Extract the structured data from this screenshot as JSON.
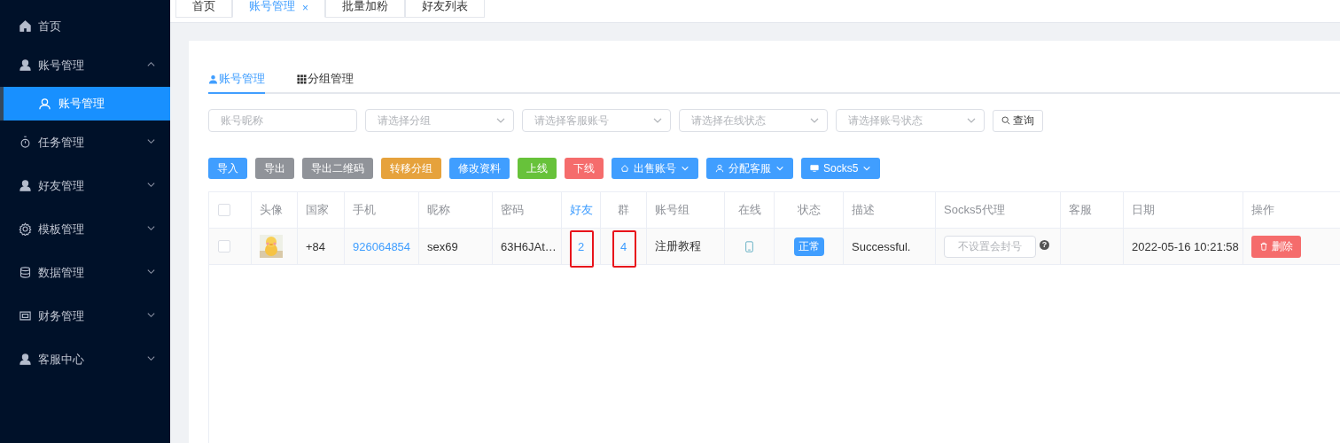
{
  "sidebar": {
    "items": [
      {
        "label": "首页",
        "kind": "link"
      },
      {
        "label": "账号管理",
        "kind": "menu",
        "expanded": true,
        "children": [
          {
            "label": "账号管理",
            "selected": true
          }
        ]
      },
      {
        "label": "任务管理",
        "kind": "menu",
        "expanded": false
      },
      {
        "label": "好友管理",
        "kind": "menu",
        "expanded": false
      },
      {
        "label": "模板管理",
        "kind": "menu",
        "expanded": false
      },
      {
        "label": "数据管理",
        "kind": "menu",
        "expanded": false
      },
      {
        "label": "财务管理",
        "kind": "menu",
        "expanded": false
      },
      {
        "label": "客服中心",
        "kind": "menu",
        "expanded": false
      }
    ]
  },
  "tabs": [
    {
      "label": "首页",
      "selected": false
    },
    {
      "label": "账号管理",
      "selected": true,
      "close": "×"
    },
    {
      "label": "批量加粉",
      "selected": false
    },
    {
      "label": "好友列表",
      "selected": false
    }
  ],
  "page_tabs": [
    {
      "label": "账号管理",
      "selected": true
    },
    {
      "label": "分组管理",
      "selected": false
    }
  ],
  "filters": [
    {
      "kind": "input",
      "placeholder": "账号昵称"
    },
    {
      "kind": "select",
      "placeholder": "请选择分组"
    },
    {
      "kind": "select",
      "placeholder": "请选择客服账号"
    },
    {
      "kind": "select",
      "placeholder": "请选择在线状态"
    },
    {
      "kind": "select",
      "placeholder": "请选择账号状态"
    }
  ],
  "search_button": "查询",
  "actions": [
    {
      "label": "导入",
      "color": "#409eff",
      "kind": "plain"
    },
    {
      "label": "导出",
      "color": "#909399",
      "kind": "plain"
    },
    {
      "label": "导出二维码",
      "color": "#909399",
      "kind": "plain"
    },
    {
      "label": "转移分组",
      "color": "#e6a23c",
      "kind": "plain"
    },
    {
      "label": "修改资料",
      "color": "#409eff",
      "kind": "plain"
    },
    {
      "label": "上线",
      "color": "#67c23a",
      "kind": "plain"
    },
    {
      "label": "下线",
      "color": "#f56c6c",
      "kind": "plain"
    },
    {
      "label": "出售账号",
      "color": "#409eff",
      "kind": "dropdown"
    },
    {
      "label": "分配客服",
      "color": "#409eff",
      "kind": "dropdown"
    },
    {
      "label": "Socks5",
      "color": "#409eff",
      "kind": "dropdown"
    }
  ],
  "table": {
    "select_all": {
      "checked": false
    },
    "columns": [
      {
        "label": "头像",
        "link": false
      },
      {
        "label": "国家",
        "link": false
      },
      {
        "label": "手机",
        "link": false
      },
      {
        "label": "昵称",
        "link": false
      },
      {
        "label": "密码",
        "link": false
      },
      {
        "label": "好友",
        "link": true
      },
      {
        "label": "群",
        "link": false
      },
      {
        "label": "账号组",
        "link": false
      },
      {
        "label": "在线",
        "link": false
      },
      {
        "label": "状态",
        "link": false
      },
      {
        "label": "描述",
        "link": false
      },
      {
        "label": "Socks5代理",
        "link": false
      },
      {
        "label": "客服",
        "link": false
      },
      {
        "label": "日期",
        "link": false
      },
      {
        "label": "操作",
        "link": false
      }
    ],
    "rows": [
      {
        "checked": false,
        "country": "+84",
        "phone": "926064854",
        "nickname": "sex69",
        "password": "63H6JAt…",
        "friends": "2",
        "friends_highlighted": true,
        "groups": "4",
        "groups_highlighted": true,
        "account_group": "注册教程",
        "online": false,
        "status": "正常",
        "description": "Successful.",
        "socks5_placeholder": "不设置会封号",
        "help": "?",
        "date": "2022-05-16 10:21:58",
        "delete": "删除"
      }
    ]
  }
}
